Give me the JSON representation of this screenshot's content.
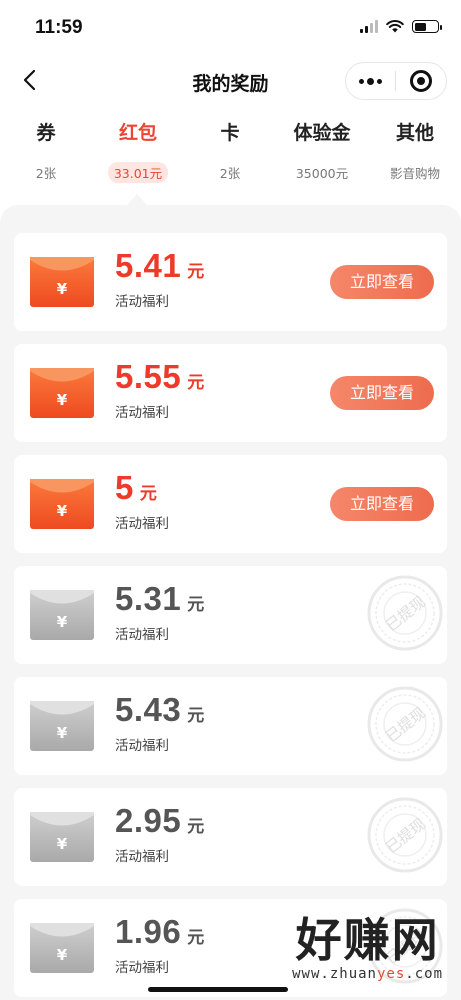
{
  "status_bar": {
    "time": "11:59"
  },
  "nav": {
    "title": "我的奖励"
  },
  "tabs": [
    {
      "label": "券",
      "sub": "2张",
      "active": false
    },
    {
      "label": "红包",
      "sub": "33.01元",
      "active": true
    },
    {
      "label": "卡",
      "sub": "2张",
      "active": false
    },
    {
      "label": "体验金",
      "sub": "35000元",
      "active": false
    },
    {
      "label": "其他",
      "sub": "影音购物",
      "active": false
    }
  ],
  "colors": {
    "accent": "#ee3a2a",
    "button": "#f0704f",
    "background": "#f5f5f6"
  },
  "rewards": [
    {
      "amount": "5.41",
      "unit": "元",
      "desc": "活动福利",
      "status": "active",
      "button": "立即查看"
    },
    {
      "amount": "5.55",
      "unit": "元",
      "desc": "活动福利",
      "status": "active",
      "button": "立即查看"
    },
    {
      "amount": "5",
      "unit": "元",
      "desc": "活动福利",
      "status": "active",
      "button": "立即查看"
    },
    {
      "amount": "5.31",
      "unit": "元",
      "desc": "活动福利",
      "status": "withdrawn",
      "stamp": "已提现"
    },
    {
      "amount": "5.43",
      "unit": "元",
      "desc": "活动福利",
      "status": "withdrawn",
      "stamp": "已提现"
    },
    {
      "amount": "2.95",
      "unit": "元",
      "desc": "活动福利",
      "status": "withdrawn",
      "stamp": "已提现"
    },
    {
      "amount": "1.96",
      "unit": "元",
      "desc": "活动福利",
      "status": "withdrawn",
      "stamp": "已提现"
    }
  ],
  "envelope_symbol": "¥",
  "watermark": {
    "main": "好赚网",
    "sub_prefix": "www.zhuan",
    "sub_accent": "yes",
    "sub_suffix": ".com"
  }
}
